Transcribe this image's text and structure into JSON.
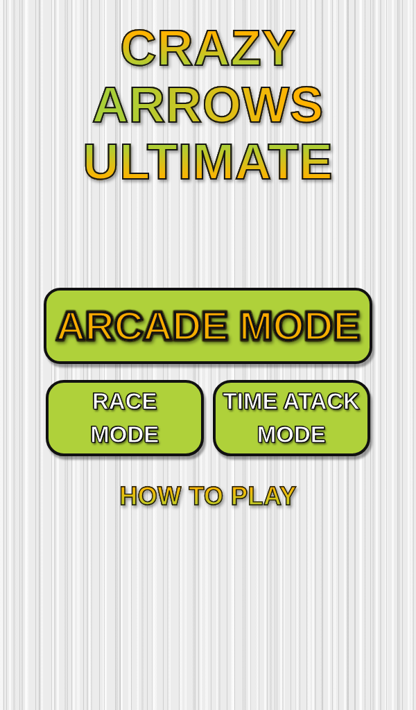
{
  "title": "CRAZY ARROWS ULTIMATE",
  "buttons": [
    {
      "label": "ARCADE MODE",
      "kind": "primary"
    },
    {
      "label": "RACE MODE",
      "kind": "secondary"
    },
    {
      "label": "TIME ATACK MODE",
      "kind": "secondary"
    }
  ],
  "link": {
    "label": "HOW TO PLAY"
  }
}
